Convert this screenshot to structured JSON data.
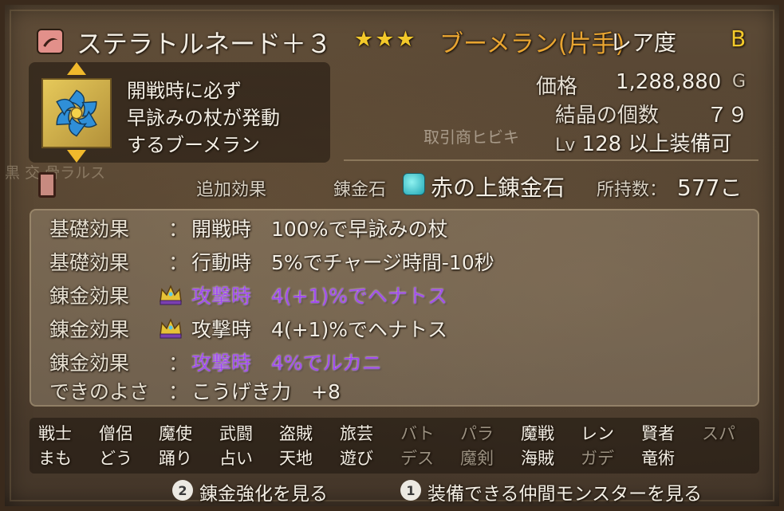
{
  "header": {
    "item_name": "ステラトルネード＋３",
    "rarity_stars": "★★★",
    "item_type": "ブーメラン(片手)",
    "rare_label": "レア度",
    "rare_grade": "B"
  },
  "description": [
    "開戦時に必ず",
    "早詠みの杖が発動",
    "するブーメラン"
  ],
  "info": {
    "price_label": "価格",
    "price_value": "1,288,880",
    "price_unit": "G",
    "crystal_label": "結晶の個数",
    "crystal_value": "７９",
    "merchant": "取引商ヒビキ",
    "level_prefix": "Lv",
    "level_value": "128",
    "level_suffix": "以上装備可"
  },
  "alchemy": {
    "ghost_text": "黒 交 骨ラルス",
    "extra_effect_label": "追加効果",
    "stone_label": "錬金石",
    "stone_name": "赤の上錬金石",
    "owned_label": "所持数：",
    "owned_value": "577こ"
  },
  "effects": [
    {
      "label": "基礎効果",
      "marker": "colon",
      "value": "開戦時　100%で早詠みの杖",
      "style": "normal"
    },
    {
      "label": "基礎効果",
      "marker": "colon",
      "value": "行動時　5%でチャージ時間-10秒",
      "style": "normal"
    },
    {
      "label": "錬金効果",
      "marker": "crown",
      "value": "攻撃時　4(+1)%でヘナトス",
      "style": "purple"
    },
    {
      "label": "錬金効果",
      "marker": "crown",
      "value": "攻撃時　4(+1)%でヘナトス",
      "style": "normal"
    },
    {
      "label": "錬金効果",
      "marker": "colon",
      "value": "攻撃時　4%でルカニ",
      "style": "purple"
    },
    {
      "label": "できのよさ",
      "marker": "colon",
      "value": "こうげき力　+8",
      "style": "normal"
    }
  ],
  "jobs_row1": [
    {
      "name": "戦士",
      "on": true
    },
    {
      "name": "僧侶",
      "on": true
    },
    {
      "name": "魔使",
      "on": true
    },
    {
      "name": "武闘",
      "on": true
    },
    {
      "name": "盗賊",
      "on": true
    },
    {
      "name": "旅芸",
      "on": true
    },
    {
      "name": "バト",
      "on": false
    },
    {
      "name": "パラ",
      "on": false
    },
    {
      "name": "魔戦",
      "on": true
    },
    {
      "name": "レン",
      "on": true
    },
    {
      "name": "賢者",
      "on": true
    },
    {
      "name": "スパ",
      "on": false
    }
  ],
  "jobs_row2": [
    {
      "name": "まも",
      "on": true
    },
    {
      "name": "どう",
      "on": true
    },
    {
      "name": "踊り",
      "on": true
    },
    {
      "name": "占い",
      "on": true
    },
    {
      "name": "天地",
      "on": true
    },
    {
      "name": "遊び",
      "on": true
    },
    {
      "name": "デス",
      "on": false
    },
    {
      "name": "魔剣",
      "on": false
    },
    {
      "name": "海賊",
      "on": true
    },
    {
      "name": "ガデ",
      "on": false
    },
    {
      "name": "竜術",
      "on": true
    }
  ],
  "footer": {
    "alchemy_badge": "2",
    "alchemy_label": "錬金強化を見る",
    "monsters_badge": "1",
    "monsters_label": "装備できる仲間モンスターを見る"
  },
  "colors": {
    "purple_effect": "#a24bf0",
    "gold": "#f3c92a",
    "item_type": "#e9a531"
  },
  "icons": [
    "boomerang-category-icon",
    "weapon-icon",
    "book-icon",
    "alchemy-stone-icon",
    "crown-icon"
  ]
}
